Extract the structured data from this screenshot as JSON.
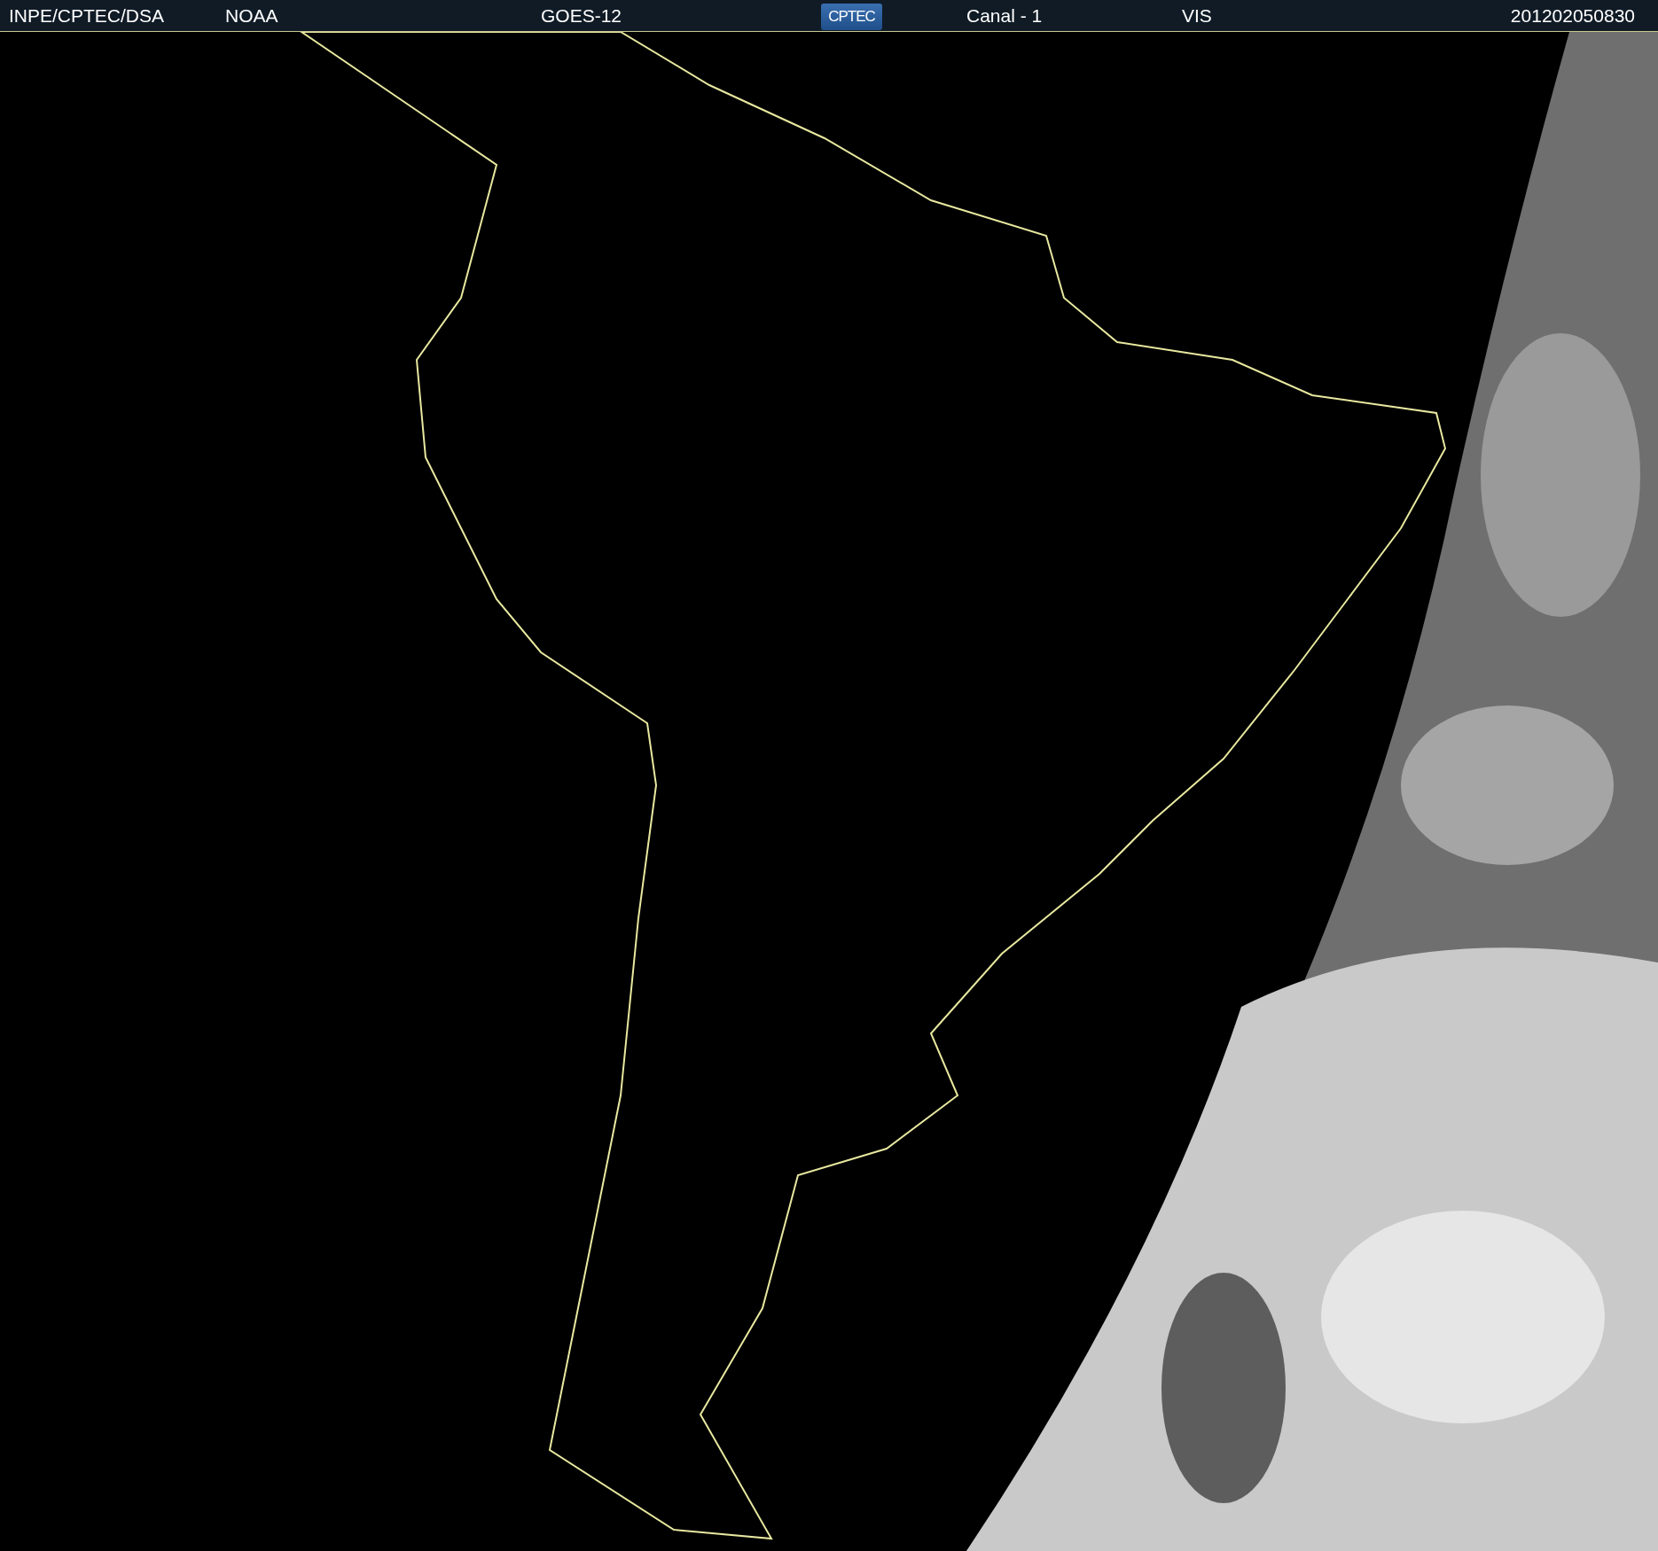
{
  "header": {
    "source": "INPE/CPTEC/DSA",
    "agency": "NOAA",
    "satellite": "GOES-12",
    "logo": "CPTEC",
    "channel": "Canal - 1",
    "band": "VIS",
    "timestamp": "201202050830"
  }
}
